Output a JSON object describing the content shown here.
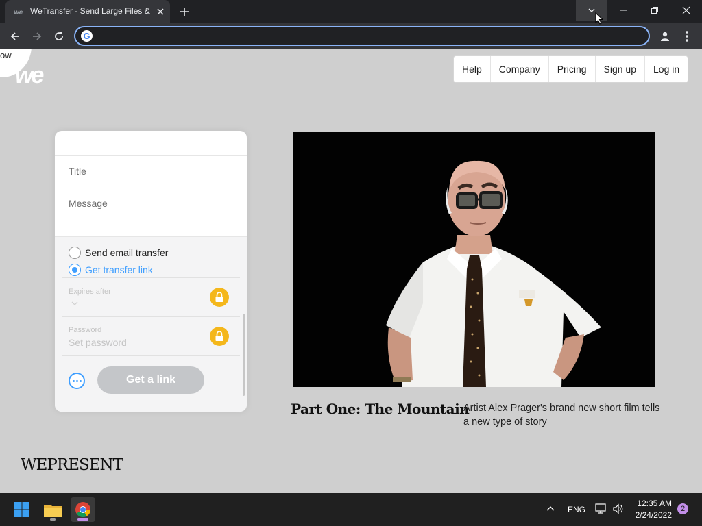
{
  "browser": {
    "tab_title": "WeTransfer - Send Large Files & Share Photos Online",
    "address_value": ""
  },
  "site": {
    "corner_text": "ow",
    "logo": "we",
    "nav": [
      "Help",
      "Company",
      "Pricing",
      "Sign up",
      "Log in"
    ]
  },
  "transfer_panel": {
    "title_placeholder": "Title",
    "message_placeholder": "Message",
    "radio_options": [
      "Send email transfer",
      "Get transfer link"
    ],
    "selected_option": "Get transfer link",
    "expires_label": "Expires after",
    "password_label": "Password",
    "password_placeholder": "Set password",
    "get_link_label": "Get a link"
  },
  "hero": {
    "title": "Part One: The Mountain",
    "description": "Artist Alex Prager's brand new short film tells a new type of story"
  },
  "footer": {
    "brand": "WEPRESENT"
  },
  "taskbar": {
    "language": "ENG",
    "time": "12:35 AM",
    "date": "2/24/2022",
    "notifications": "2"
  },
  "colors": {
    "accent_blue": "#409fff",
    "lock_yellow": "#f4b71b",
    "page_bg": "#cfcfcf"
  },
  "icons": [
    "wetransfer-favicon",
    "close-icon",
    "plus-icon",
    "chevron-down-icon",
    "minimize-icon",
    "restore-icon",
    "back-icon",
    "forward-icon",
    "reload-icon",
    "google-icon",
    "profile-icon",
    "more-vert-icon",
    "lock-icon",
    "more-horizontal-icon",
    "windows-start-icon",
    "file-explorer-icon",
    "chrome-icon",
    "network-icon",
    "volume-icon"
  ]
}
